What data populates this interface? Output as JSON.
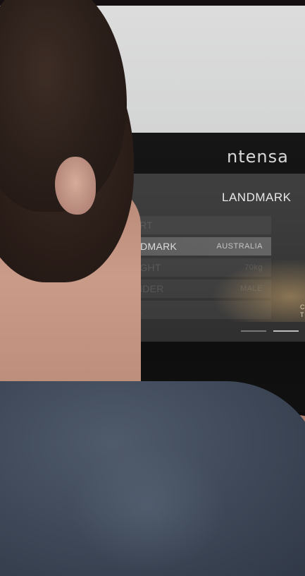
{
  "device": {
    "brand_logo": "ntensa",
    "screen": {
      "title": "LANDMARK",
      "menu": [
        {
          "icon": "flag-icon",
          "label": "START",
          "value": "",
          "selected": false
        },
        {
          "icon": "tower-icon",
          "label": "LANDMARK",
          "value": "AUSTRALIA",
          "selected": true
        },
        {
          "icon": "weight-icon",
          "label": "WEIGHT",
          "value": "70kg",
          "selected": false
        },
        {
          "icon": "gender-icon",
          "label": "GENDER",
          "value": "MALE",
          "selected": false
        },
        {
          "icon": "age-icon",
          "label": "AGE",
          "value": "",
          "selected": false
        }
      ],
      "side_text": [
        "C",
        "T"
      ]
    }
  },
  "colors": {
    "screen_bg": "#3b3b3b",
    "selected_row": "#5a5a5a",
    "shirt": "#3f4959",
    "wall": "#d6d7d7"
  }
}
